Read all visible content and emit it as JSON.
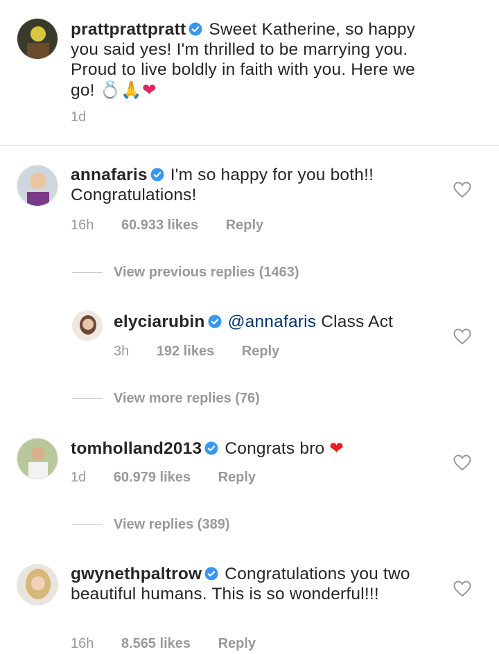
{
  "comments": [
    {
      "username": "prattprattpratt",
      "text": "Sweet Katherine, so happy you said yes! I'm thrilled to be marrying you. Proud to live boldly in faith with you. Here we go!",
      "emoji": "💍🙏❤",
      "time": "1d"
    },
    {
      "username": "annafaris",
      "text": "I'm so happy for you both!! Congratulations!",
      "time": "16h",
      "likes": "60.933 likes",
      "reply": "Reply",
      "view_replies": "View previous replies (1463)"
    },
    {
      "username": "elyciarubin",
      "mention": "@annafaris",
      "text": "Class Act",
      "time": "3h",
      "likes": "192 likes",
      "reply": "Reply",
      "view_replies": "View more replies (76)"
    },
    {
      "username": "tomholland2013",
      "text": "Congrats bro",
      "emoji": "❤",
      "time": "1d",
      "likes": "60.979 likes",
      "reply": "Reply",
      "view_replies": "View replies (389)"
    },
    {
      "username": "gwynethpaltrow",
      "text": "Congratulations you two beautiful humans. This is so wonderful!!!",
      "time": "16h",
      "likes": "8.565 likes",
      "reply": "Reply"
    }
  ],
  "colors": {
    "verified": "#3897f0",
    "heart_red": "#ed1c24",
    "muted": "#999999"
  },
  "icons": [
    "verified-badge-icon",
    "heart-outline-icon"
  ]
}
